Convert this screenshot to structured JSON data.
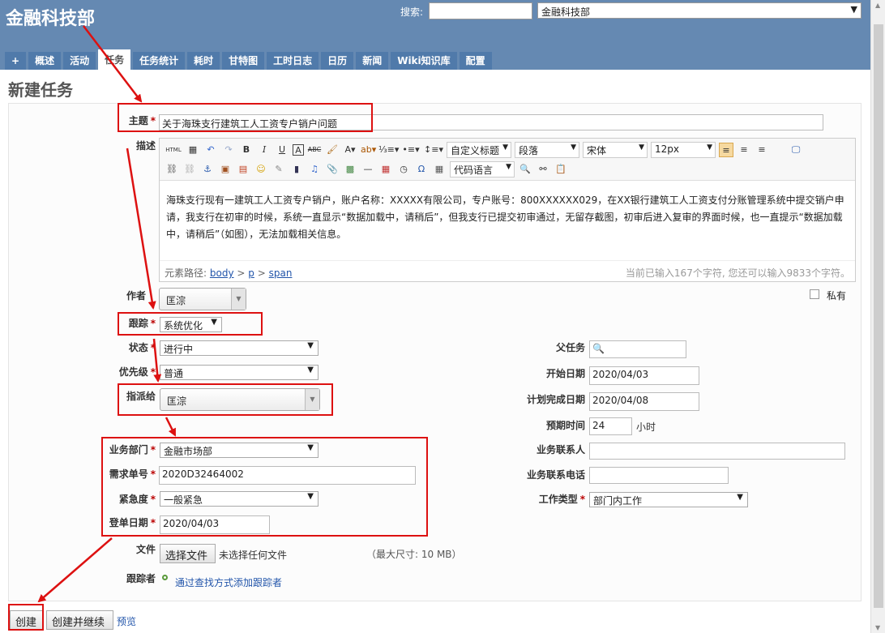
{
  "header": {
    "site_title": "金融科技部",
    "search_label": "搜索:",
    "search_value": "",
    "project_select": "金融科技部"
  },
  "tabs": [
    {
      "label": "+"
    },
    {
      "label": "概述"
    },
    {
      "label": "活动"
    },
    {
      "label": "任务"
    },
    {
      "label": "任务统计"
    },
    {
      "label": "耗时"
    },
    {
      "label": "甘特图"
    },
    {
      "label": "工时日志"
    },
    {
      "label": "日历"
    },
    {
      "label": "新闻"
    },
    {
      "label": "Wiki知识库"
    },
    {
      "label": "配置"
    }
  ],
  "page_title": "新建任务",
  "form": {
    "subject_label": "主题",
    "subject_value": "关于海珠支行建筑工人工资专户销户问题",
    "description_label": "描述",
    "description_text": "海珠支行现有一建筑工人工资专户销户，账户名称：XXXXX有限公司，专户账号：800XXXXXX029，在XX银行建筑工人工资支付分账管理系统中提交销户申请，我支行在初审的时候，系统一直显示“数据加载中，请稍后”，但我支行已提交初审通过，无留存截图，初审后进入复审的界面时候，也一直提示“数据加载中，请稍后”（如图），无法加载相关信息。",
    "author_label": "作者",
    "author_value": "匡淙",
    "private_label": "私有",
    "tracker_label": "跟踪",
    "tracker_value": "系统优化",
    "status_label": "状态",
    "status_value": "进行中",
    "priority_label": "优先级",
    "priority_value": "普通",
    "assignee_label": "指派给",
    "assignee_value": "匡淙",
    "parent_label": "父任务",
    "start_label": "开始日期",
    "start_value": "2020/04/03",
    "due_label": "计划完成日期",
    "due_value": "2020/04/08",
    "estimate_label": "预期时间",
    "estimate_value": "24",
    "estimate_unit": "小时",
    "dept_label": "业务部门",
    "dept_value": "金融市场部",
    "req_no_label": "需求单号",
    "req_no_value": "2020D32464002",
    "urgency_label": "紧急度",
    "urgency_value": "一般紧急",
    "reg_date_label": "登单日期",
    "reg_date_value": "2020/04/03",
    "contact_label": "业务联系人",
    "contact_value": "",
    "phone_label": "业务联系电话",
    "phone_value": "",
    "work_type_label": "工作类型",
    "work_type_value": "部门内工作",
    "file_label": "文件",
    "file_button": "选择文件",
    "file_none": "未选择任何文件",
    "file_max": "（最大尺寸: 10 MB）",
    "watchers_label": "跟踪者",
    "watchers_link": "通过查找方式添加跟踪者"
  },
  "editor": {
    "format_select": "自定义标题",
    "paragraph_select": "段落",
    "font_select": "宋体",
    "size_select": "12px",
    "code_select": "代码语言",
    "path_prefix": "元素路径:",
    "path_body": "body",
    "path_sep1": ">",
    "path_p": "p",
    "path_sep2": ">",
    "path_span": "span",
    "char_count": "当前已输入167个字符, 您还可以输入9833个字符。"
  },
  "actions": {
    "create": "创建",
    "create_continue": "创建并继续",
    "preview": "预览"
  },
  "colors": {
    "header_bg": "#6589b2",
    "tab_bg": "#507aaa",
    "annotation_red": "#dd1111",
    "required_red": "#bb0000",
    "link_blue": "#2255aa"
  }
}
